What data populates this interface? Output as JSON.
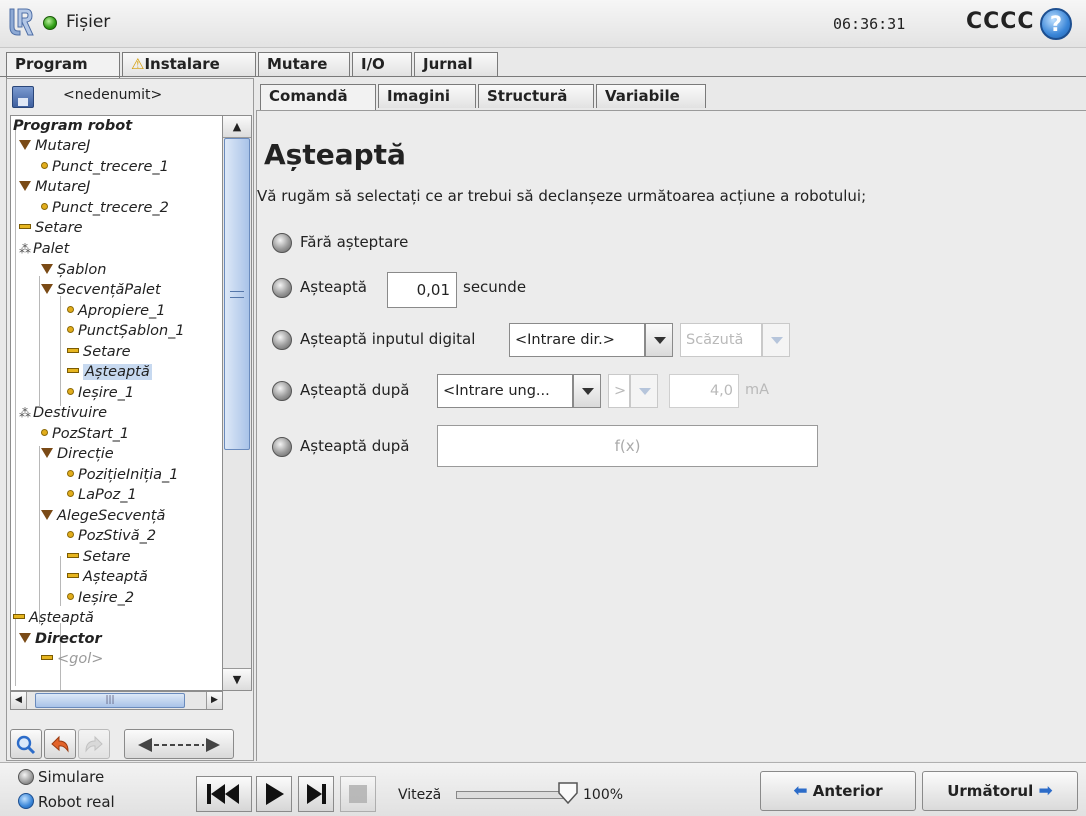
{
  "titlebar": {
    "file_menu": "Fișier",
    "clock": "06:36:31",
    "robot_name": "CCCC",
    "help_glyph": "?"
  },
  "main_tabs": [
    {
      "label": "Program",
      "active": true
    },
    {
      "label": "Instalare",
      "warning_icon": "warning-icon"
    },
    {
      "label": "Mutare"
    },
    {
      "label": "I/O"
    },
    {
      "label": "Jurnal"
    }
  ],
  "program_name": "<nedenumit>",
  "sub_tabs": [
    {
      "label": "Comandă",
      "active": true
    },
    {
      "label": "Imagini"
    },
    {
      "label": "Structură"
    },
    {
      "label": "Variabile"
    }
  ],
  "tree": [
    {
      "label": "Program robot",
      "icon": "none",
      "bold": true
    },
    {
      "label": "MutareJ",
      "icon": "move-icon"
    },
    {
      "label": "Punct_trecere_1",
      "icon": "waypoint-icon"
    },
    {
      "label": "MutareJ",
      "icon": "move-icon"
    },
    {
      "label": "Punct_trecere_2",
      "icon": "waypoint-icon"
    },
    {
      "label": "Setare",
      "icon": "set-icon"
    },
    {
      "label": "Palet",
      "icon": "pallet-icon"
    },
    {
      "label": "Șablon",
      "icon": "move-icon"
    },
    {
      "label": "SecvențăPalet",
      "icon": "move-icon"
    },
    {
      "label": "Apropiere_1",
      "icon": "waypoint-icon"
    },
    {
      "label": "PunctȘablon_1",
      "icon": "waypoint-icon"
    },
    {
      "label": "Setare",
      "icon": "set-icon"
    },
    {
      "label": "Așteaptă",
      "icon": "set-icon",
      "selected": true
    },
    {
      "label": "Ieșire_1",
      "icon": "waypoint-icon"
    },
    {
      "label": "Destivuire",
      "icon": "pallet-icon"
    },
    {
      "label": "PozStart_1",
      "icon": "waypoint-icon"
    },
    {
      "label": "Direcție",
      "icon": "move-icon"
    },
    {
      "label": "PozițieInițiа_1",
      "icon": "waypoint-icon"
    },
    {
      "label": "LaPoz_1",
      "icon": "waypoint-icon"
    },
    {
      "label": "AlegeSecvență",
      "icon": "move-icon"
    },
    {
      "label": "PozStivă_2",
      "icon": "waypoint-icon"
    },
    {
      "label": "Setare",
      "icon": "set-icon"
    },
    {
      "label": "Așteaptă",
      "icon": "set-icon"
    },
    {
      "label": "Ieșire_2",
      "icon": "waypoint-icon"
    },
    {
      "label": "Așteaptă",
      "icon": "set-icon"
    },
    {
      "label": "Director",
      "icon": "move-icon",
      "bold": true
    },
    {
      "label": "<gol>",
      "icon": "set-icon",
      "gray": true
    }
  ],
  "command": {
    "title": "Așteaptă",
    "instruction": "Vă rugăm să selectați ce ar trebui să declanșeze următoarea acțiune a robotului;",
    "options": {
      "no_wait": "Fără așteptare",
      "wait_time": "Așteaptă",
      "wait_time_value": "0,01",
      "wait_time_unit": "secunde",
      "wait_digital": "Așteaptă inputul digital",
      "digital_input": "<Intrare dir.>",
      "digital_state": "Scăzută",
      "wait_analog": "Așteaptă după",
      "analog_input": "<Intrare ung...",
      "analog_operator": ">",
      "analog_value": "4,0",
      "analog_unit": "mA",
      "wait_expression": "Așteaptă după",
      "expression_placeholder": "f(x)"
    }
  },
  "bottom": {
    "mode_simulation": "Simulare",
    "mode_real": "Robot real",
    "speed_label": "Viteză",
    "speed_value": "100%",
    "speed_fraction": 1.0,
    "prev_label": "Anterior",
    "next_label": "Următorul"
  },
  "colors": {
    "status_green": "#2f9d15",
    "help_blue": "#3a86d8",
    "selection": "#c7d9f0",
    "icon_gold": "#e2ad1c"
  }
}
